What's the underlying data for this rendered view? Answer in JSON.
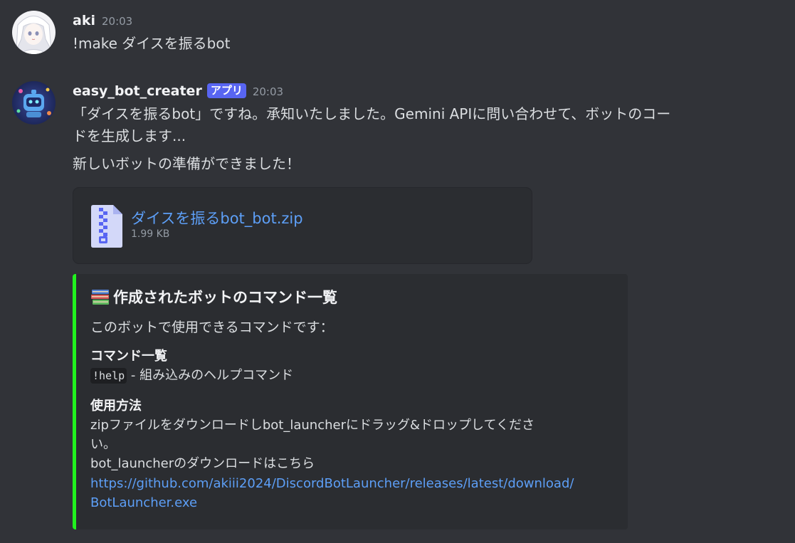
{
  "messages": [
    {
      "username": "aki",
      "timestamp": "20:03",
      "text": "!make ダイスを振るbot"
    },
    {
      "username": "easy_bot_creater",
      "badge": "アプリ",
      "timestamp": "20:03",
      "lines": [
        "「ダイスを振るbot」ですね。承知いたしました。Gemini APIに問い合わせて、ボットのコー",
        "ドを生成します...",
        "新しいボットの準備ができました！"
      ],
      "attachment": {
        "file_name": "ダイスを振るbot_bot.zip",
        "file_size": "1.99 KB",
        "icon": "zip-file-icon"
      },
      "embed": {
        "accent_color": "#21f21e",
        "title_icon": "books-icon",
        "title": "作成されたボットのコマンド一覧",
        "description": "このボットで使用できるコマンドです：",
        "fields": [
          {
            "name": "コマンド一覧",
            "code": "!help",
            "value": " - 組み込みのヘルプコマンド"
          },
          {
            "name": "使用方法",
            "lines": [
              "zipファイルをダウンロードしbot_launcherにドラッグ&ドロップしてくださ",
              "い。",
              "bot_launcherのダウンロードはこちら"
            ],
            "link_lines": [
              "https://github.com/akiii2024/DiscordBotLauncher/releases/latest/download/",
              "BotLauncher.exe"
            ]
          }
        ]
      }
    }
  ],
  "colors": {
    "background": "#313338",
    "link": "#5d9ff7",
    "badge": "#5865f2"
  }
}
